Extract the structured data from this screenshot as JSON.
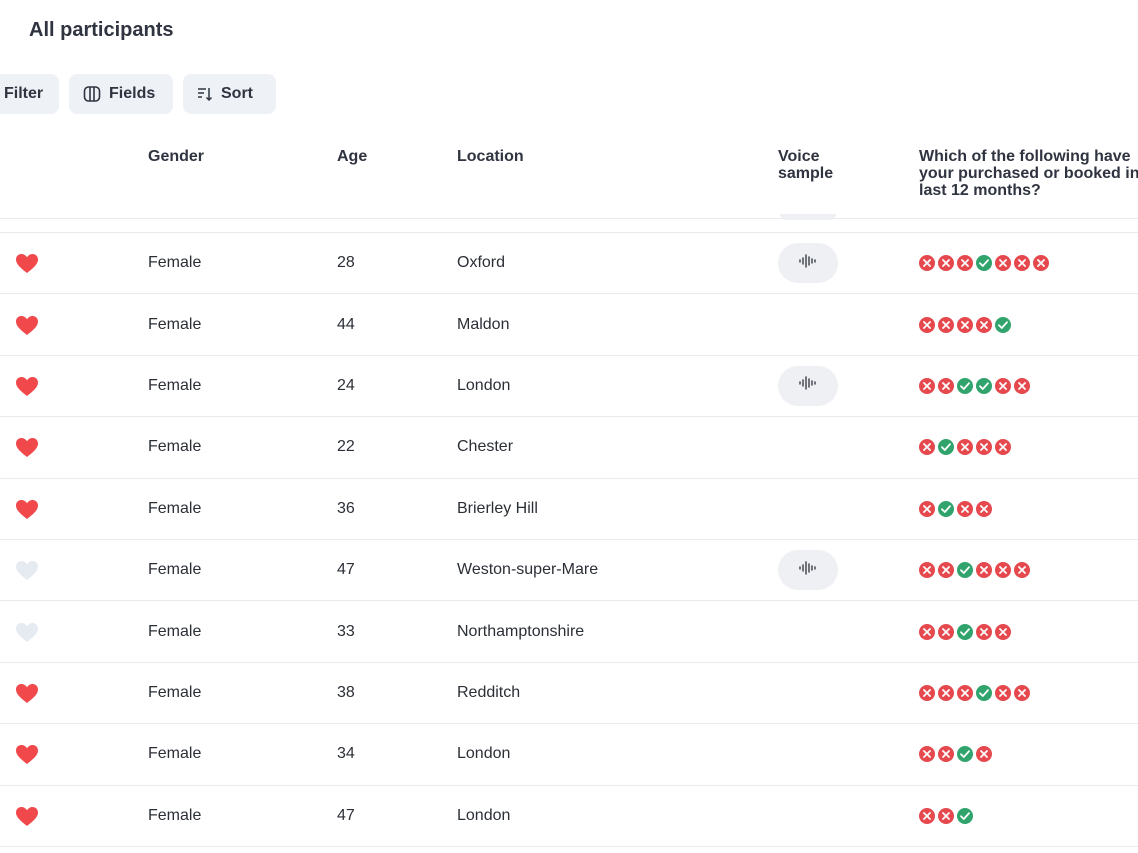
{
  "page": {
    "title": "All participants"
  },
  "toolbar": {
    "filter_label": "Filter",
    "fields_label": "Fields",
    "sort_label": "Sort"
  },
  "columns": {
    "gender": "Gender",
    "age": "Age",
    "location": "Location",
    "voice": "Voice sample",
    "question": "Which of the following have your purchased or booked in last 12 months?"
  },
  "colors": {
    "favorite_on": "#f0484b",
    "favorite_off": "#e6eaf1",
    "answer_no": "#e5484d",
    "answer_yes": "#30a46c"
  },
  "participants": [
    {
      "favorite": true,
      "gender": "Female",
      "age": "28",
      "location": "Oxford",
      "voice": true,
      "answers": [
        "no",
        "no",
        "no",
        "yes",
        "no",
        "no",
        "no"
      ]
    },
    {
      "favorite": true,
      "gender": "Female",
      "age": "44",
      "location": "Maldon",
      "voice": false,
      "answers": [
        "no",
        "no",
        "no",
        "no",
        "yes"
      ]
    },
    {
      "favorite": true,
      "gender": "Female",
      "age": "24",
      "location": "London",
      "voice": true,
      "answers": [
        "no",
        "no",
        "yes",
        "yes",
        "no",
        "no"
      ]
    },
    {
      "favorite": true,
      "gender": "Female",
      "age": "22",
      "location": "Chester",
      "voice": false,
      "answers": [
        "no",
        "yes",
        "no",
        "no",
        "no"
      ]
    },
    {
      "favorite": true,
      "gender": "Female",
      "age": "36",
      "location": "Brierley Hill",
      "voice": false,
      "answers": [
        "no",
        "yes",
        "no",
        "no"
      ]
    },
    {
      "favorite": false,
      "gender": "Female",
      "age": "47",
      "location": "Weston-super-Mare",
      "voice": true,
      "answers": [
        "no",
        "no",
        "yes",
        "no",
        "no",
        "no"
      ]
    },
    {
      "favorite": false,
      "gender": "Female",
      "age": "33",
      "location": "Northamptonshire",
      "voice": false,
      "answers": [
        "no",
        "no",
        "yes",
        "no",
        "no"
      ]
    },
    {
      "favorite": true,
      "gender": "Female",
      "age": "38",
      "location": "Redditch",
      "voice": false,
      "answers": [
        "no",
        "no",
        "no",
        "yes",
        "no",
        "no"
      ]
    },
    {
      "favorite": true,
      "gender": "Female",
      "age": "34",
      "location": "London",
      "voice": false,
      "answers": [
        "no",
        "no",
        "yes",
        "no"
      ]
    },
    {
      "favorite": true,
      "gender": "Female",
      "age": "47",
      "location": "London",
      "voice": false,
      "answers": [
        "no",
        "no",
        "yes"
      ]
    }
  ]
}
